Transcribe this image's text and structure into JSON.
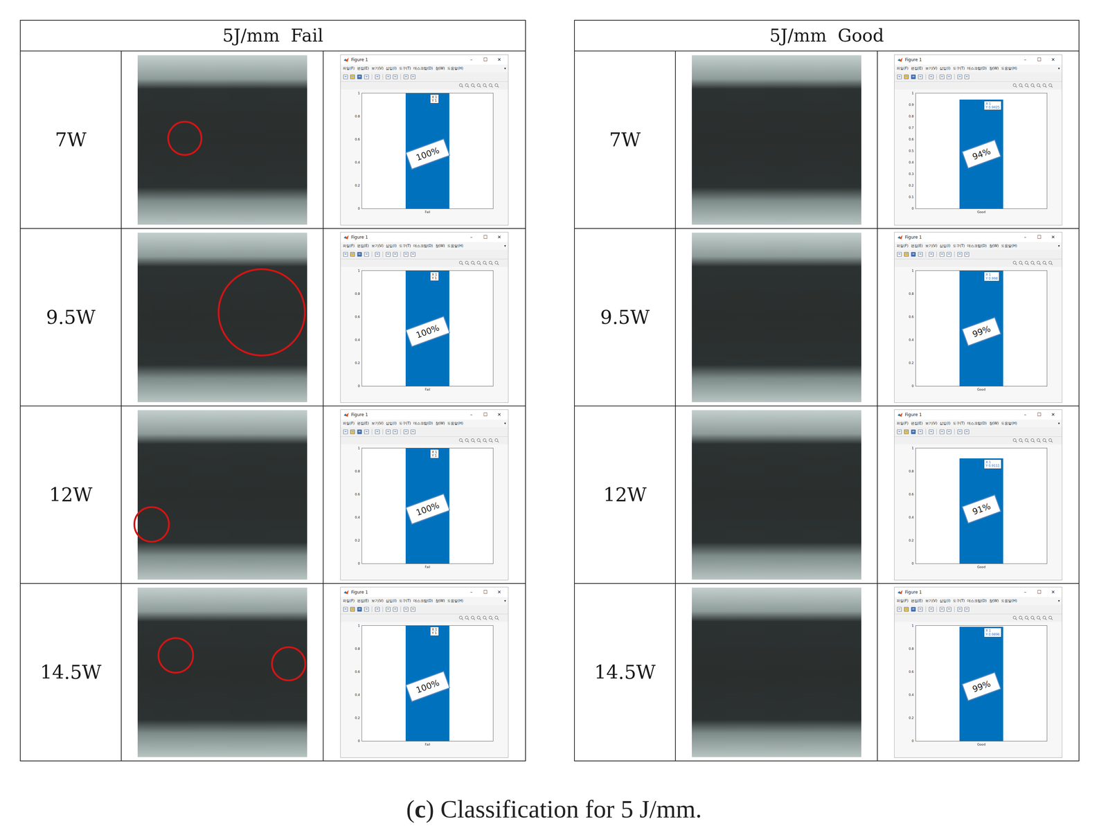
{
  "figure_window": {
    "title": "Figure 1",
    "controls": [
      "–",
      "☐",
      "✕"
    ],
    "menus": [
      "파일(F)",
      "편집(E)",
      "보기(V)",
      "삽입(I)",
      "도구(T)",
      "데스크탑(D)",
      "창(W)",
      "도움말(H)"
    ],
    "menu_more": "▾"
  },
  "panels": [
    {
      "title": "5J/mm  Fail",
      "rows": [
        {
          "power": "7W",
          "circles": 1,
          "chart": {
            "y_ticks": [
              "0",
              "0.2",
              "0.4",
              "0.6",
              "0.8",
              "1"
            ],
            "values": [
              1
            ],
            "x_label": "Fail",
            "tip": [
              "X 1",
              "Y 1"
            ],
            "tip_color": "#222222",
            "annotation": "100%"
          }
        },
        {
          "power": "9.5W",
          "circles": 1,
          "chart": {
            "y_ticks": [
              "0",
              "0.2",
              "0.4",
              "0.6",
              "0.8",
              "1"
            ],
            "values": [
              1
            ],
            "x_label": "Fail",
            "tip": [
              "X 1",
              "Y 1"
            ],
            "tip_color": "#222222",
            "annotation": "100%"
          }
        },
        {
          "power": "12W",
          "circles": 1,
          "chart": {
            "y_ticks": [
              "0",
              "0.2",
              "0.4",
              "0.6",
              "0.8",
              "1"
            ],
            "values": [
              1
            ],
            "x_label": "Fail",
            "tip": [
              "X 1",
              "Y 1"
            ],
            "tip_color": "#222222",
            "annotation": "100%"
          }
        },
        {
          "power": "14.5W",
          "circles": 2,
          "chart": {
            "y_ticks": [
              "0",
              "0.2",
              "0.4",
              "0.6",
              "0.8",
              "1"
            ],
            "values": [
              1
            ],
            "x_label": "Fail",
            "tip": [
              "X 1",
              "Y 1"
            ],
            "tip_color": "#222222",
            "annotation": "100%"
          }
        }
      ]
    },
    {
      "title": "5J/mm  Good",
      "rows": [
        {
          "power": "7W",
          "circles": 0,
          "chart": {
            "y_ticks": [
              "0",
              "0.1",
              "0.2",
              "0.3",
              "0.4",
              "0.5",
              "0.6",
              "0.7",
              "0.8",
              "0.9",
              "1"
            ],
            "values": [
              0.9425
            ],
            "x_label": "Good",
            "tip": [
              "X 1",
              "Y 0.9425"
            ],
            "tip_color": "#1a73d9",
            "annotation": "94%"
          }
        },
        {
          "power": "9.5W",
          "circles": 0,
          "chart": {
            "y_ticks": [
              "0",
              "0.2",
              "0.4",
              "0.6",
              "0.8",
              "1"
            ],
            "values": [
              0.998
            ],
            "x_label": "Good",
            "tip": [
              "X 1",
              "Y 0.998"
            ],
            "tip_color": "#1a73d9",
            "annotation": "99%"
          }
        },
        {
          "power": "12W",
          "circles": 0,
          "chart": {
            "y_ticks": [
              "0",
              "0.2",
              "0.4",
              "0.6",
              "0.8",
              "1"
            ],
            "values": [
              0.9111
            ],
            "x_label": "Good",
            "tip": [
              "X 1",
              "Y 0.9111"
            ],
            "tip_color": "#1a73d9",
            "annotation": "91%"
          }
        },
        {
          "power": "14.5W",
          "circles": 0,
          "chart": {
            "y_ticks": [
              "0",
              "0.2",
              "0.4",
              "0.6",
              "0.8",
              "1"
            ],
            "values": [
              0.9896
            ],
            "x_label": "Good",
            "tip": [
              "X 1",
              "Y 0.9896"
            ],
            "tip_color": "#1a73d9",
            "annotation": "99%"
          }
        }
      ]
    }
  ],
  "caption": {
    "prefix": "(",
    "letter": "c",
    "suffix": ") Classification for 5 J/mm."
  }
}
